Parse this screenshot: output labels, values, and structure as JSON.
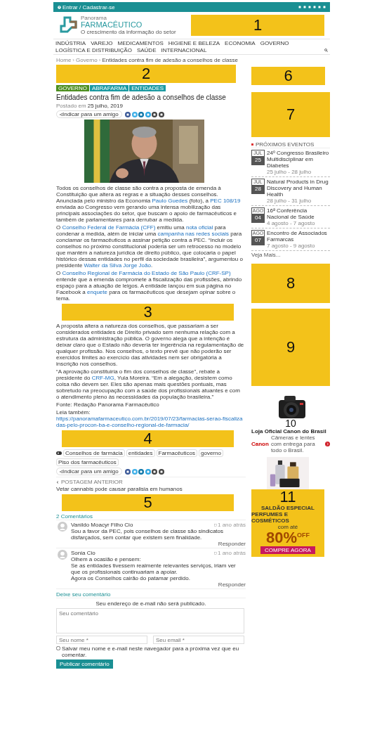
{
  "top_bar": {
    "login": "Entrar / Cadastrar-se"
  },
  "logo": {
    "line1": "Panorama",
    "line2": "FARMACÊUTICO",
    "tagline": "O crescimento da informação do setor"
  },
  "header_ad": {
    "label": "1"
  },
  "nav": {
    "items": [
      "INDÚSTRIA",
      "VAREJO",
      "MEDICAMENTOS",
      "HIGIENE E BELEZA",
      "ECONOMIA",
      "GOVERNO",
      "LOGÍSTICA E DISTRIBUIÇÃO",
      "SAÚDE",
      "INTERNACIONAL"
    ]
  },
  "breadcrumb": [
    {
      "kind": "link",
      "text": "Home"
    },
    {
      "kind": "separator",
      "text": "›"
    },
    {
      "kind": "link",
      "text": "Governo"
    },
    {
      "kind": "separator",
      "text": "›"
    },
    {
      "kind": "current",
      "text": "Entidades contra fim de adesão a conselhos de classe"
    }
  ],
  "article": {
    "ad_top": {
      "label": "2"
    },
    "categories": [
      {
        "label": "GOVERNO",
        "color": "#4d8f1f"
      },
      {
        "label": "ABRAFARMA",
        "color": "#1b9aa2"
      },
      {
        "label": "ENTIDADES",
        "color": "#1b9aa2"
      }
    ],
    "title": "Entidades contra fim de adesão a conselhos de classe",
    "posted_prefix": "Postado em",
    "date": "25 julho, 2019",
    "share_label": "Indicar para um amigo",
    "paragraphs_1": [
      [
        {
          "kind": "text",
          "text": "Todos os conselhos de classe são contra a proposta de emenda à Constituição que altera as regras e a situação desses conselhos. Anunciada pelo ministro da Economia "
        },
        {
          "kind": "link",
          "text": "Paulo Guedes"
        },
        {
          "kind": "text",
          "text": " (foto), a "
        },
        {
          "kind": "link",
          "text": "PEC 108/19"
        },
        {
          "kind": "text",
          "text": " enviada ao Congresso vem gerando uma intensa mobilização das principais associações do setor, que buscam o apoio de farmacêuticos e também de parlamentares para derrubar a medida."
        }
      ],
      [
        {
          "kind": "text",
          "text": "O "
        },
        {
          "kind": "link",
          "text": "Conselho Federal de Farmácia (CFF)"
        },
        {
          "kind": "text",
          "text": " emitiu uma "
        },
        {
          "kind": "link",
          "text": "nota oficial"
        },
        {
          "kind": "text",
          "text": " para condenar a medida, além de iniciar uma "
        },
        {
          "kind": "link",
          "text": "campanha nas redes sociais"
        },
        {
          "kind": "text",
          "text": " para conclamar os farmacêuticos a assinar petição contra a PEC. “Incluir os conselhos no próximo constitucional poderia ser um retrocesso no modelo que mantém a natureza jurídica de direito público, que colocaria o papel histórico dessas entidades no perfil da sociedade brasileira”, argumentou o presidente "
        },
        {
          "kind": "link",
          "text": "Walter da Silva Jorge João"
        },
        {
          "kind": "text",
          "text": "."
        }
      ],
      [
        {
          "kind": "text",
          "text": "O "
        },
        {
          "kind": "link",
          "text": "Conselho Regional de Farmácia do Estado de São Paulo (CRF-SP)"
        },
        {
          "kind": "text",
          "text": " entende que a emenda compromete a fiscalização das profissões, abrindo espaço para a atuação de leigos. A entidade lançou em sua página no Facebook a "
        },
        {
          "kind": "link",
          "text": "enquete"
        },
        {
          "kind": "text",
          "text": " para os farmacêuticos que desejam opinar sobre o tema."
        }
      ]
    ],
    "ad_middle": {
      "label": "3"
    },
    "paragraphs_2": [
      [
        {
          "kind": "text",
          "text": "A proposta altera a natureza dos conselhos, que passariam a ser considerados entidades de Direito privado sem nenhuma relação com a estrutura da administração pública. O governo alega que a intenção é deixar claro que o Estado não deveria ter ingerência na regulamentação de qualquer profissão. Nos conselhos, o texto prevê que não poderão ser exercidos limites ao exercício das atividades nem ser obrigatória a inscrição nos conselhos."
        }
      ],
      [
        {
          "kind": "text",
          "text": "“A aprovação constituiria o fim dos conselhos de classe”, rebate a presidente do "
        },
        {
          "kind": "link",
          "text": "CRF-MG"
        },
        {
          "kind": "text",
          "text": ", Yula Moreira. “Em a alegação, desistem como coisa não devem ser. Eles são apenas mais questões pontuais, mas sobretudo na preocupação com a saúde dos profissionais atuantes e com o atendimento pleno às necessidades da população brasileira.”"
        }
      ],
      [
        {
          "kind": "text",
          "text": "Fonte: Redação Panorama Farmacêutico"
        }
      ],
      [
        {
          "kind": "text",
          "text": "Leia também: "
        },
        {
          "kind": "url",
          "text": "https://panoramafarmaceutico.com.br/2019/07/23/farmacias-serao-fiscalizadas-pelo-procon-ba-e-conselho-regional-de-farmacia/"
        }
      ]
    ],
    "ad_bottom": {
      "label": "4"
    },
    "tags": [
      "Conselhos de farmácia",
      "entidades",
      "Farmacêuticos",
      "governo",
      "Piso dos farmacêuticos"
    ],
    "share_label_2": "Indicar para um amigo",
    "previous": {
      "label": "POSTAGEM ANTERIOR",
      "title": "Vetar cannabis pode causar paralisia em humanos"
    },
    "ad_after": {
      "label": "5"
    }
  },
  "comments": {
    "heading": "2 Comentários",
    "items": [
      {
        "author": "Vanildo Moacyr Filho Cio",
        "time": "1 ano atrás",
        "lines": [
          "Sou a favor da PEC, pois conselhos de classe são sindicatos disfarçados, sem contar que existem sem finalidade."
        ],
        "reply": "Responder"
      },
      {
        "author": "Sonia Cio",
        "time": "1 ano atrás",
        "lines": [
          "Olhem a ocasião e pensem:",
          "Se as entidades tivessem realmente relevantes serviços, iriam ver que os profissionais continuariam a apoiar.",
          "Agora os Conselhos cairão do patamar perdido."
        ],
        "reply": "Responder"
      }
    ]
  },
  "comment_form": {
    "heading": "Deixe seu comentário",
    "note": "Seu endereço de e-mail não será publicado.",
    "comment_placeholder": "Seu comentário",
    "name_placeholder": "Seu nome *",
    "email_placeholder": "Seu email *",
    "save_label": "Salvar meu nome e e-mail neste navegador para a próxima vez que eu comentar.",
    "save_checked": false,
    "submit": "Publicar comentário"
  },
  "sidebar": {
    "ad_1": {
      "label": "6"
    },
    "ad_2": {
      "label": "7"
    },
    "events": {
      "heading": "PRÓXIMOS EVENTOS",
      "more": "Veja Mais...",
      "items": [
        {
          "month": "JUL",
          "day": "25",
          "title": "24º Congresso Brasileiro Multidisciplinar em Diabetes",
          "dates": "25 julho - 28 julho"
        },
        {
          "month": "JUL",
          "day": "28",
          "title": "Natural Products in Drug Discovery and Human Health",
          "dates": "28 julho - 31 julho"
        },
        {
          "month": "AGO",
          "day": "04",
          "title": "16ª Conferência Nacional de Saúde",
          "dates": "4 agosto - 7 agosto"
        },
        {
          "month": "AGO",
          "day": "07",
          "title": "Encontro de Associados Farmarcas",
          "dates": "7 agosto - 9 agosto"
        }
      ]
    },
    "ad_3": {
      "label": "8"
    },
    "ad_4": {
      "label": "9"
    },
    "canon_ad": {
      "label": "10",
      "title": "Loja Oficial Canon do Brasil",
      "brand": "Canon",
      "text": "Câmeras e lentes com entrega para todo o Brasil."
    },
    "perfume_ad": {
      "label": "11",
      "line1": "SALDÃO ESPECIAL",
      "line2": "PERFUMES E COSMÉTICOS",
      "prefix": "com até",
      "percent": "80%",
      "off": "OFF",
      "cta": "COMPRE AGORA"
    }
  }
}
